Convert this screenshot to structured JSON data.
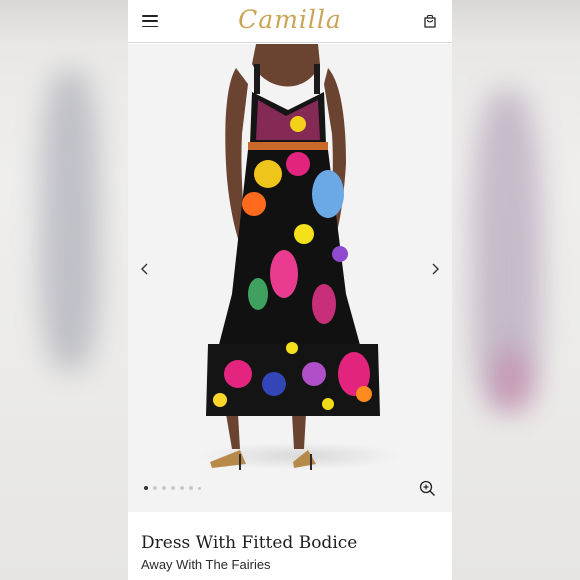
{
  "header": {
    "brand": "Camilla",
    "menu_icon": "hamburger-menu-icon",
    "cart_icon": "shopping-bag-icon"
  },
  "gallery": {
    "prev_icon": "chevron-left-icon",
    "next_icon": "chevron-right-icon",
    "zoom_icon": "zoom-in-icon",
    "image_count": 7,
    "active_index": 0
  },
  "product": {
    "title": "Dress With Fitted Bodice",
    "collection": "Away With The Fairies"
  },
  "colors": {
    "brand_gold": "#c9a455",
    "background": "#ffffff",
    "gallery_bg": "#f3f3f3"
  }
}
